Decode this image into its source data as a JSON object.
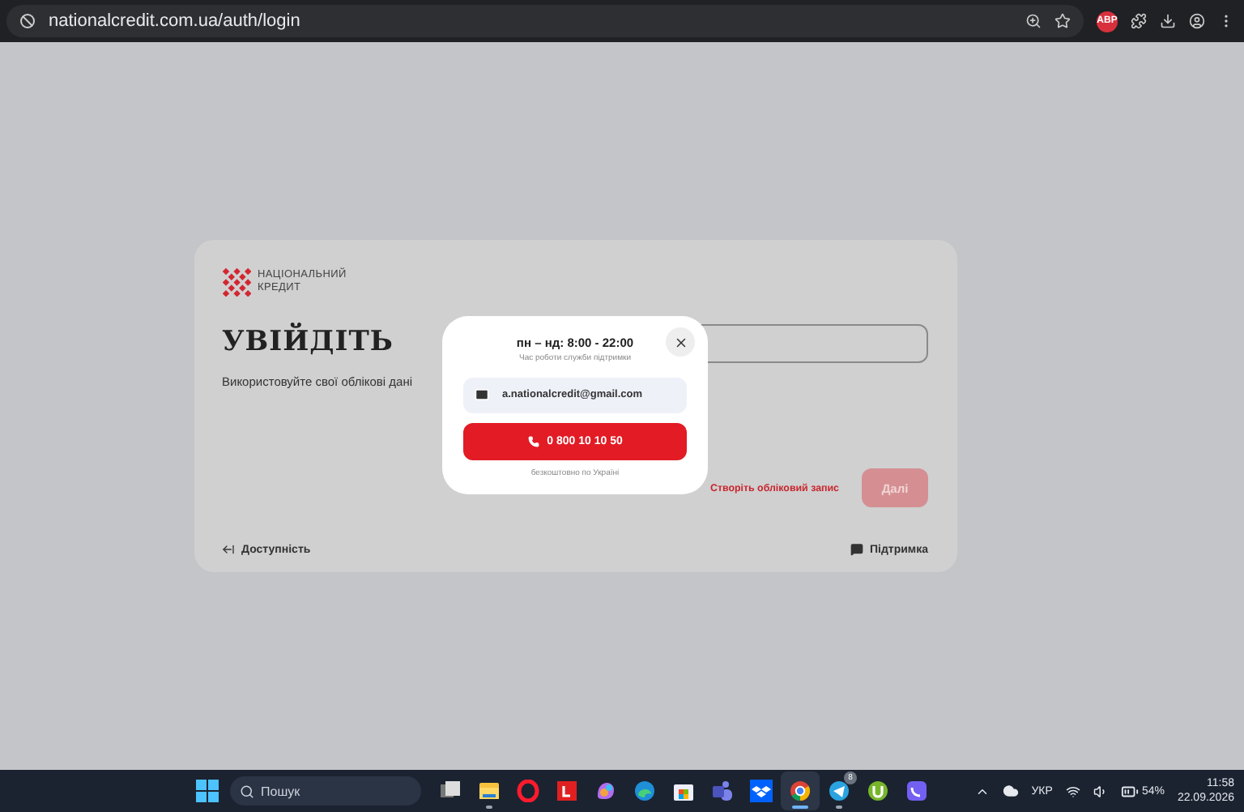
{
  "browser": {
    "url": "nationalcredit.com.ua/auth/login",
    "extension_badge": "ABP"
  },
  "logo": {
    "lines": [
      "НАЦІОНАЛЬНИЙ",
      "КРЕДИТ"
    ]
  },
  "login": {
    "title": "УВІЙДІТЬ",
    "subtitle": "Використовуйте свої облікові дані",
    "create_account_link": "Створіть обліковий запис",
    "next_button": {
      "label": "Далі",
      "disabled": true
    }
  },
  "footer": {
    "accessibility": "Доступність",
    "support": "Підтримка"
  },
  "support_modal": {
    "hours": "пн – нд: 8:00 - 22:00",
    "hours_caption": "Час роботи служби підтримки",
    "email": "a.nationalcredit@gmail.com",
    "phone": "0 800 10 10 50",
    "phone_caption": "безкоштовно по Україні"
  },
  "taskbar": {
    "search_placeholder": "Пошук",
    "apps": [
      {
        "kind": "task-view",
        "running": false,
        "selected": false
      },
      {
        "kind": "file-explorer",
        "running": true,
        "selected": false
      },
      {
        "kind": "opera",
        "running": false,
        "selected": false
      },
      {
        "kind": "l-app",
        "running": false,
        "selected": false
      },
      {
        "kind": "copilot",
        "running": false,
        "selected": false
      },
      {
        "kind": "edge",
        "running": false,
        "selected": false
      },
      {
        "kind": "store",
        "running": false,
        "selected": false
      },
      {
        "kind": "teams",
        "running": false,
        "selected": false
      },
      {
        "kind": "dropbox",
        "running": false,
        "selected": false
      },
      {
        "kind": "chrome",
        "running": true,
        "selected": true
      },
      {
        "kind": "telegram",
        "running": true,
        "selected": false,
        "badge": "8"
      },
      {
        "kind": "utorrent",
        "running": false,
        "selected": false
      },
      {
        "kind": "viber",
        "running": false,
        "selected": false
      }
    ],
    "tray": {
      "language": "УКР",
      "battery": "54%",
      "time": "11:58",
      "date": "22.09.2026"
    }
  }
}
